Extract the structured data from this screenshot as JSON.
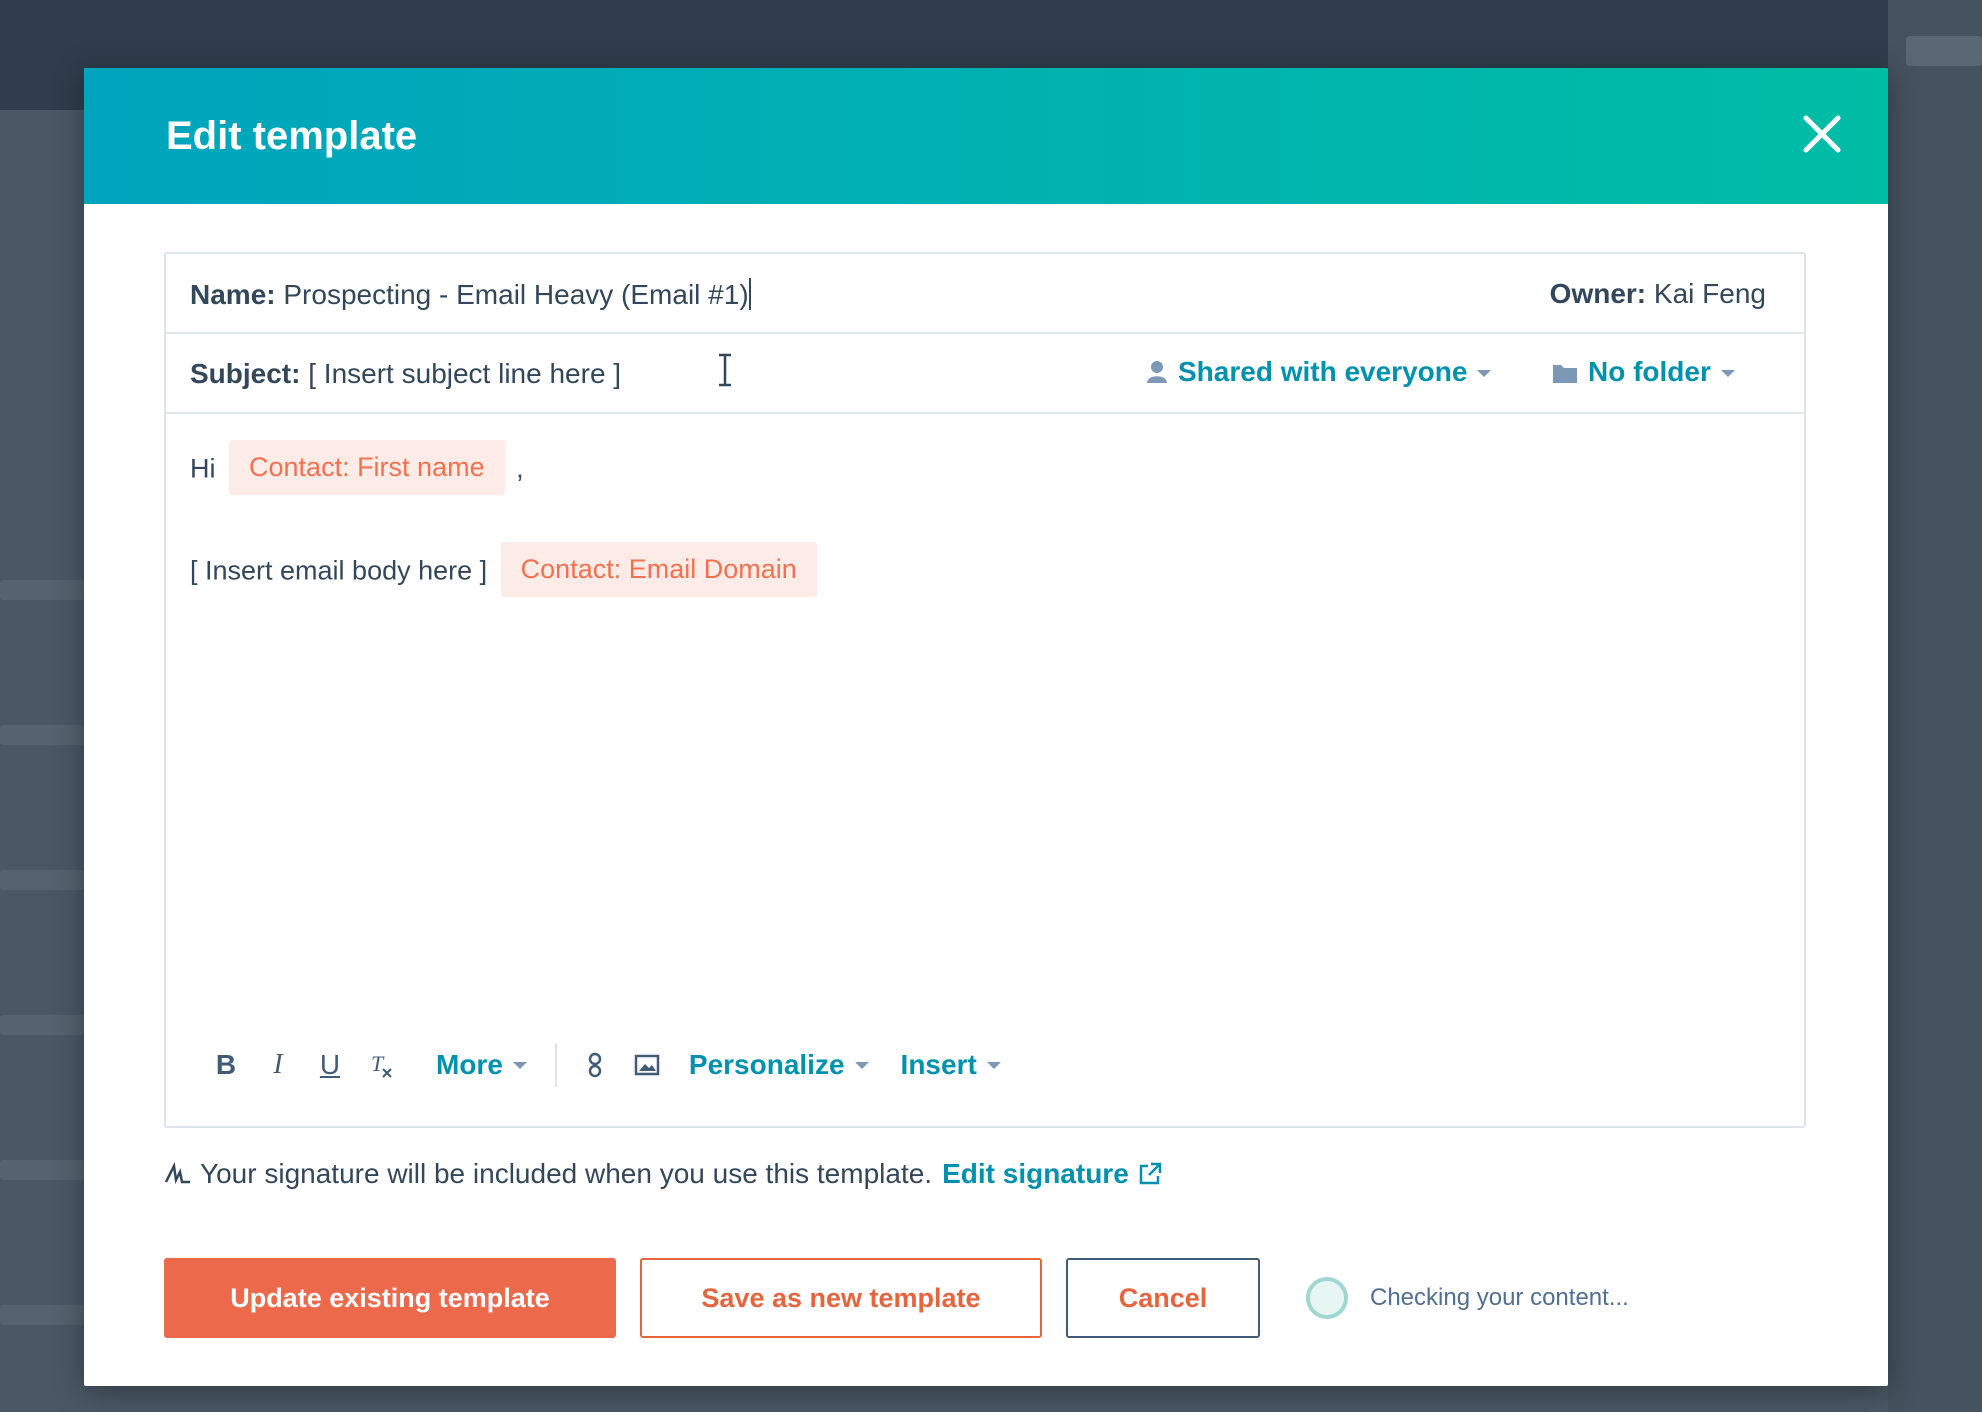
{
  "modal": {
    "title": "Edit template"
  },
  "fields": {
    "name_label": "Name:",
    "name_value": "Prospecting - Email Heavy (Email #1)",
    "owner_label": "Owner:",
    "owner_value": "Kai Feng",
    "subject_label": "Subject:",
    "subject_value": "[ Insert subject line here ]",
    "sharing": "Shared with everyone",
    "folder": "No folder"
  },
  "body": {
    "greeting": "Hi",
    "token_first_name": "Contact: First name",
    "comma": ",",
    "body_text": "[ Insert email body here ]",
    "token_email_domain": "Contact: Email Domain"
  },
  "toolbar": {
    "bold": "B",
    "italic": "I",
    "underline": "U",
    "more": "More",
    "personalize": "Personalize",
    "insert": "Insert"
  },
  "signature": {
    "text": "Your signature will be included when you use this template.",
    "link": "Edit signature"
  },
  "footer": {
    "update_label": "Update existing template",
    "save_new_label": "Save as new template",
    "cancel_label": "Cancel",
    "status": "Checking your content..."
  },
  "colors": {
    "header_start": "#00a4bd",
    "header_end": "#00bda5",
    "primary_button": "#ec6a4b",
    "link": "#0091ae",
    "token_bg": "#fdebe7",
    "token_text": "#f2714e"
  }
}
